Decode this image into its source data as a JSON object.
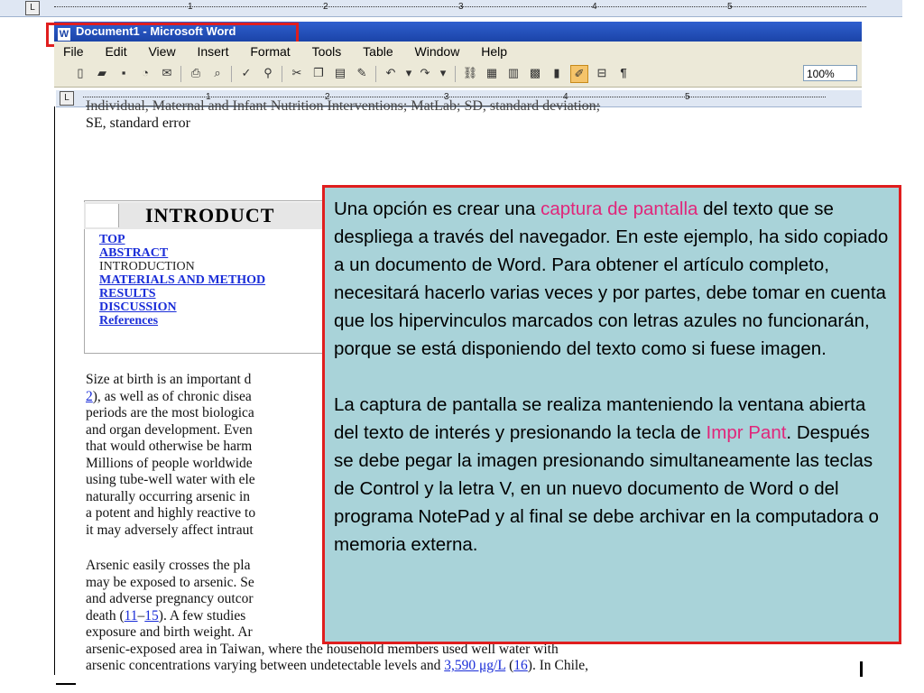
{
  "window": {
    "title": "Document1 - Microsoft Word"
  },
  "menu": [
    "File",
    "Edit",
    "View",
    "Insert",
    "Format",
    "Tools",
    "Table",
    "Window",
    "Help"
  ],
  "toolbar": {
    "zoom": "100%"
  },
  "ruler": {
    "top_numbers": [
      "1",
      "2",
      "3",
      "4",
      "5"
    ],
    "inner_numbers": [
      "1",
      "2",
      "3",
      "4",
      "5"
    ]
  },
  "document": {
    "legend_line1": "Individual, Maternal and Infant Nutrition Interventions; MatLab; SD, standard deviation;",
    "legend_line2": "SE, standard error",
    "section_heading": "INTRODUCT",
    "toc": [
      "TOP",
      "ABSTRACT",
      "INTRODUCTION",
      "MATERIALS AND METHOD",
      "RESULTS",
      "DISCUSSION",
      "References"
    ],
    "para1": [
      "Size at birth is an important d",
      "), as well as of chronic disea",
      "periods are the most biologica",
      "and organ development. Even",
      "that would otherwise be harm",
      "Millions of people worldwide",
      "using tube-well water with ele",
      "naturally occurring arsenic in",
      "a potent and highly reactive to",
      "it may adversely affect intraut"
    ],
    "para1_link": "2",
    "para2": [
      "Arsenic easily crosses the pla",
      "may be exposed to arsenic. Se",
      "and adverse pregnancy outcor",
      "death (",
      "exposure and birth weight. Ar",
      "arsenic-exposed area in Taiwan, where the household members used well water with",
      "arsenic concentrations varying between undetectable levels and "
    ],
    "para2_link1": "11",
    "para2_link_sep": "–",
    "para2_link2": "15",
    "para2_after_link": "). A few studies",
    "para2_value": "3,590 μg/L",
    "para2_space": " (",
    "para2_link3": "16",
    "para2_end": "). In Chile,"
  },
  "note": {
    "p1_a": "Una opción es crear una ",
    "p1_hl": "captura de pantalla",
    "p1_b": " del texto que se despliega a través del navegador.  En este ejemplo, ha sido copiado a un documento de Word.  Para obtener el artículo completo, necesitará hacerlo varias veces y por partes, debe tomar en cuenta que los hipervinculos marcados con letras azules no funcionarán, porque se está disponiendo del texto como si fuese imagen.",
    "p2_a": "La captura de pantalla se realiza manteniendo la ventana abierta del texto de interés y presionando la tecla de ",
    "p2_hl": "Impr Pant",
    "p2_b": ".  Después se debe pegar la imagen presionando simultaneamente las teclas de Control y la letra V, en un nuevo documento de Word o del programa NotePad y al final se debe archivar en la computadora o memoria externa.",
    "highlight_color": "#e0267a",
    "background_color": "#a9d3d9",
    "border_color": "#e01e1e"
  }
}
